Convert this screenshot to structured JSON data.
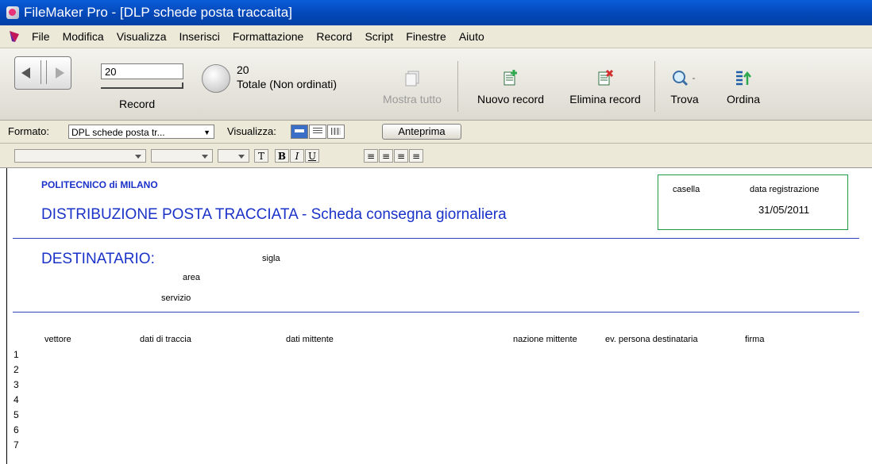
{
  "window": {
    "title": "FileMaker Pro - [DLP schede posta traccaita]"
  },
  "menu": [
    "File",
    "Modifica",
    "Visualizza",
    "Inserisci",
    "Formattazione",
    "Record",
    "Script",
    "Finestre",
    "Aiuto"
  ],
  "status": {
    "record_value": "20",
    "record_label": "Record",
    "found_count": "20",
    "total_label": "Totale (Non ordinati)",
    "show_all": "Mostra tutto",
    "new_record": "Nuovo record",
    "delete_record": "Elimina record",
    "find": "Trova",
    "sort": "Ordina"
  },
  "layout_bar": {
    "format_label": "Formato:",
    "format_value": "DPL schede posta tr...",
    "view_label": "Visualizza:",
    "preview": "Anteprima"
  },
  "text_format": {
    "bold": "B",
    "italic": "I",
    "underline": "U",
    "text_tool": "T"
  },
  "document": {
    "org": "POLITECNICO di MILANO",
    "title": "DISTRIBUZIONE POSTA TRACCIATA - Scheda consegna giornaliera",
    "box": {
      "casella": "casella",
      "data_label": "data registrazione",
      "data_value": "31/05/2011"
    },
    "destinatario": "DESTINATARIO:",
    "sigla": "sigla",
    "area": "area",
    "servizio": "servizio",
    "columns": [
      "vettore",
      "dati di traccia",
      "dati mittente",
      "nazione mittente",
      "ev. persona destinataria",
      "firma"
    ],
    "rows": [
      "1",
      "2",
      "3",
      "4",
      "5",
      "6",
      "7"
    ]
  }
}
